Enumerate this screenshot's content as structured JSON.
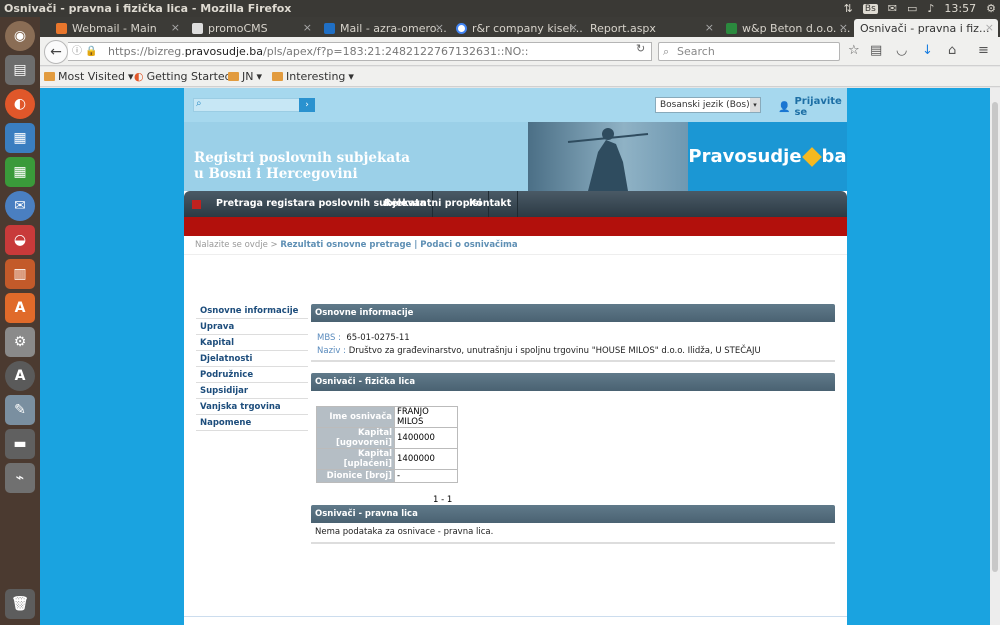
{
  "os": {
    "window_title": "Osnivači - pravna i fizička lica - Mozilla Firefox",
    "tray": {
      "keyboard": "Bs",
      "time": "13:57"
    }
  },
  "browser": {
    "tabs": [
      {
        "label": "Webmail - Main",
        "active": false
      },
      {
        "label": "promoCMS",
        "active": false
      },
      {
        "label": "Mail - azra-omero...",
        "active": false
      },
      {
        "label": "r&r company kisel...",
        "active": false
      },
      {
        "label": "Report.aspx",
        "active": false
      },
      {
        "label": "w&p Beton d.o.o. ...",
        "active": false
      },
      {
        "label": "Osnivači - pravna i fiz...",
        "active": true
      }
    ],
    "url_prefix": "https://bizreg.",
    "url_domain": "pravosudje.ba",
    "url_rest": "/pls/apex/f?p=183:21:2482122767132631::NO::",
    "search_placeholder": "Search",
    "bookmarks": [
      "Most Visited",
      "Getting Started",
      "JN",
      "Interesting"
    ]
  },
  "site": {
    "search_go": "›",
    "language": "Bosanski jezik (Bos)",
    "login": "Prijavite se",
    "banner_title_1": "Registri poslovnih subjekata",
    "banner_title_2": "u Bosni i Hercegovini",
    "logo_left": "Pravosudje",
    "logo_right": "ba",
    "menu": [
      "Pretraga registara poslovnih subjekata",
      "Relevantni propisi",
      "Kontakt"
    ],
    "breadcrumb_prefix": "Nalazite se ovdje >",
    "breadcrumb_current": "Rezultati osnovne pretrage | Podaci o osnivačima",
    "sidebar": [
      "Osnovne informacije",
      "Uprava",
      "Kapital",
      "Djelatnosti",
      "Podružnice",
      "Supsidijar",
      "Vanjska trgovina",
      "Napomene"
    ],
    "basic": {
      "heading": "Osnovne informacije",
      "mbs_label": "MBS :",
      "mbs_value": "65-01-0275-11",
      "naziv_label": "Naziv :",
      "naziv_value": "Društvo za građevinarstvo, unutrašnju i spoljnu trgovinu \"HOUSE MILOS\" d.o.o. Ilidža, U STEČAJU"
    },
    "natural": {
      "heading": "Osnivači - fizička lica",
      "rows": [
        {
          "key": "Ime osnivača",
          "value": "FRANJO MILOS"
        },
        {
          "key": "Kapital [ugovoreni]",
          "value": "1400000"
        },
        {
          "key": "Kapital [uplaćeni]",
          "value": "1400000"
        },
        {
          "key": "Dionice [broj]",
          "value": "-"
        }
      ],
      "pagination": "1 - 1"
    },
    "legal": {
      "heading": "Osnivači - pravna lica",
      "message": "Nema podataka za osnivace - pravna lica."
    }
  }
}
